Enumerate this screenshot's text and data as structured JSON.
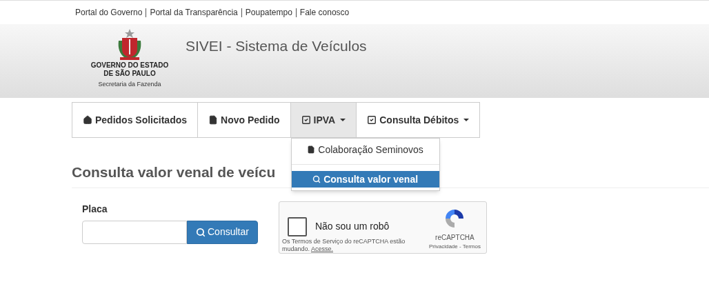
{
  "top_links": [
    "Portal do Governo",
    "Portal da Transparência",
    "Poupatempo",
    "Fale conosco"
  ],
  "header": {
    "logo_lines": [
      "GOVERNO DO ESTADO",
      "DE SÃO PAULO"
    ],
    "logo_subtitle": "Secretaria da Fazenda",
    "title": "SIVEI - Sistema de Veículos"
  },
  "nav": [
    {
      "label": "Pedidos Solicitados",
      "kind": "home",
      "dropdown": false,
      "selected": false
    },
    {
      "label": "Novo Pedido",
      "kind": "file",
      "dropdown": false,
      "selected": false
    },
    {
      "label": "IPVA",
      "kind": "check",
      "dropdown": true,
      "selected": true,
      "menu": [
        {
          "label": "Colaboração Seminovos",
          "kind": "file",
          "selected": false
        },
        {
          "label": "Consulta valor venal",
          "kind": "search",
          "selected": true
        }
      ]
    },
    {
      "label": "Consulta Débitos",
      "kind": "check",
      "dropdown": true,
      "selected": false
    }
  ],
  "heading": "Consulta valor venal de veícu",
  "form": {
    "label": "Placa",
    "button": "Consultar"
  },
  "captcha": {
    "checked": false,
    "label": "Não sou um robô",
    "notice": "Os Termos de Serviço do reCAPTCHA estão mudando.",
    "link": "Acesse.",
    "brand": "reCAPTCHA",
    "footer": "Privacidade - Termos"
  }
}
